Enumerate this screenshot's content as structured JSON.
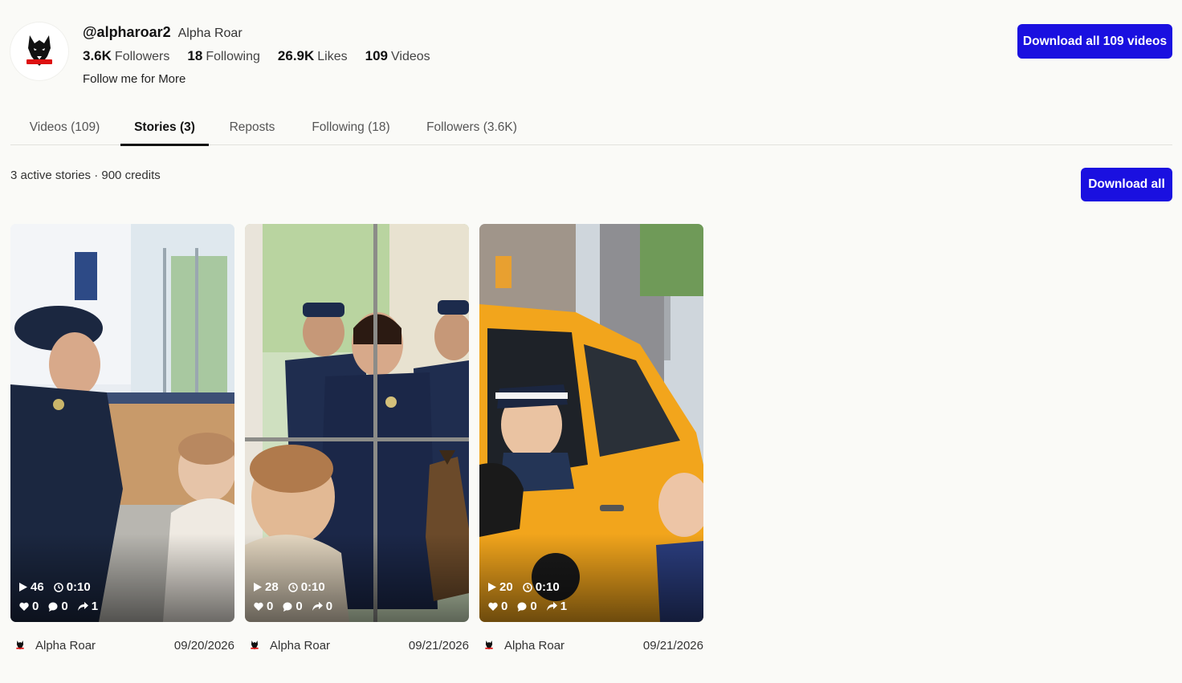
{
  "profile": {
    "handle": "@alpharoar2",
    "display_name": "Alpha Roar",
    "bio": "Follow me for More",
    "stats": [
      {
        "value": "3.6K",
        "label": "Followers"
      },
      {
        "value": "18",
        "label": "Following"
      },
      {
        "value": "26.9K",
        "label": "Likes"
      },
      {
        "value": "109",
        "label": "Videos"
      }
    ],
    "download_all_videos_label": "Download all 109 videos"
  },
  "tabs": [
    {
      "label": "Videos (109)",
      "active": false
    },
    {
      "label": "Stories (3)",
      "active": true
    },
    {
      "label": "Reposts",
      "active": false
    },
    {
      "label": "Following (18)",
      "active": false
    },
    {
      "label": "Followers (3.6K)",
      "active": false
    }
  ],
  "stories_summary": "3 active stories · 900 credits",
  "download_all_label": "Download all",
  "stories": [
    {
      "views": "46",
      "duration": "0:10",
      "likes": "0",
      "comments": "0",
      "shares": "1",
      "author": "Alpha Roar",
      "date": "09/20/2026",
      "scene": "police officer bending to smile at a toddler inside a police station lobby"
    },
    {
      "views": "28",
      "duration": "0:10",
      "likes": "0",
      "comments": "0",
      "shares": "0",
      "author": "Alpha Roar",
      "date": "09/21/2026",
      "scene": "police officers and a K9 dog looking through a glass door at a toddler"
    },
    {
      "views": "20",
      "duration": "0:10",
      "likes": "0",
      "comments": "0",
      "shares": "1",
      "author": "Alpha Roar",
      "date": "09/21/2026",
      "scene": "toddler in a police cap riding in a yellow taxi talking to a little girl on a city street"
    }
  ],
  "icons": {
    "avatar": "wolf-logo-icon",
    "views": "play-icon",
    "duration": "clock-icon",
    "likes": "heart-icon",
    "comments": "comment-icon",
    "shares": "share-icon"
  },
  "colors": {
    "primary_button": "#1a10e0",
    "background": "#fafaf7"
  }
}
